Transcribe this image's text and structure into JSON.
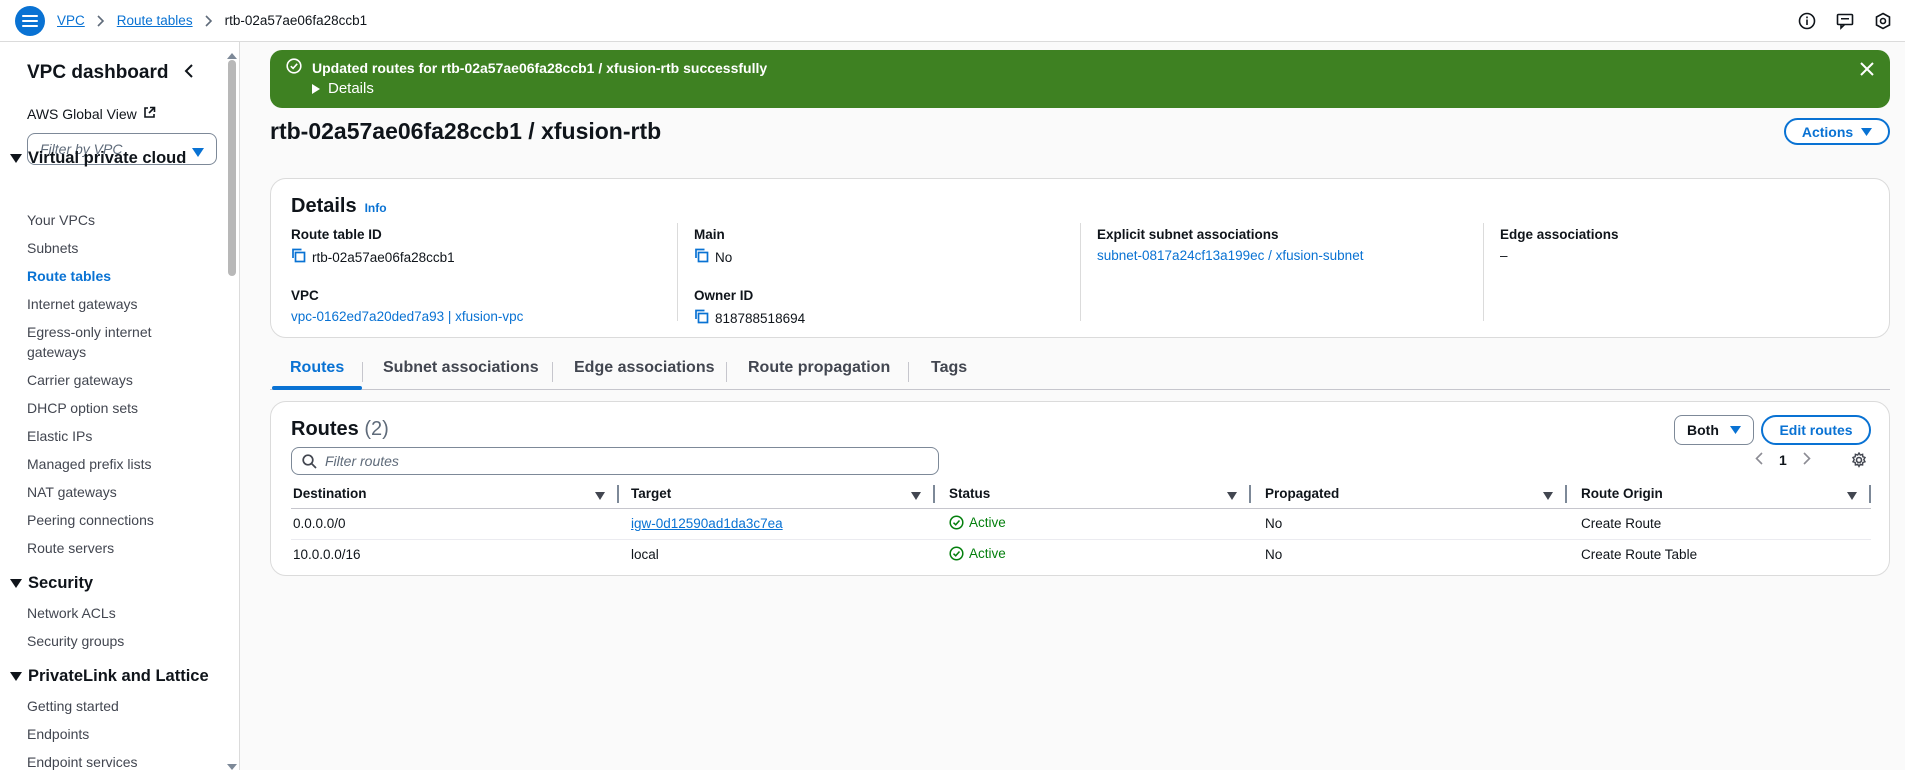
{
  "breadcrumb": {
    "items": [
      "VPC",
      "Route tables"
    ],
    "current": "rtb-02a57ae06fa28ccb1"
  },
  "sidebar": {
    "title": "VPC dashboard",
    "global_view": "AWS Global View",
    "filter_placeholder": "Filter by VPC",
    "sections": [
      {
        "title": "Virtual private cloud",
        "items": [
          "Your VPCs",
          "Subnets",
          "Route tables",
          "Internet gateways",
          "Egress-only internet gateways",
          "Carrier gateways",
          "DHCP option sets",
          "Elastic IPs",
          "Managed prefix lists",
          "NAT gateways",
          "Peering connections",
          "Route servers"
        ]
      },
      {
        "title": "Security",
        "items": [
          "Network ACLs",
          "Security groups"
        ]
      },
      {
        "title": "PrivateLink and Lattice",
        "items": [
          "Getting started",
          "Endpoints",
          "Endpoint services"
        ]
      }
    ],
    "active_item": "Route tables"
  },
  "flash": {
    "message": "Updated routes for rtb-02a57ae06fa28ccb1 / xfusion-rtb successfully",
    "details_label": "Details",
    "color": "#3e8122"
  },
  "page": {
    "title": "rtb-02a57ae06fa28ccb1 / xfusion-rtb",
    "actions_label": "Actions"
  },
  "details": {
    "title": "Details",
    "info_label": "Info",
    "route_table_id_label": "Route table ID",
    "route_table_id": "rtb-02a57ae06fa28ccb1",
    "main_label": "Main",
    "main": "No",
    "explicit_label": "Explicit subnet associations",
    "explicit": "subnet-0817a24cf13a199ec / xfusion-subnet",
    "edge_label": "Edge associations",
    "edge": "–",
    "vpc_label": "VPC",
    "vpc": "vpc-0162ed7a20ded7a93 | xfusion-vpc",
    "owner_label": "Owner ID",
    "owner": "818788518694"
  },
  "tabs": [
    "Routes",
    "Subnet associations",
    "Edge associations",
    "Route propagation",
    "Tags"
  ],
  "routes": {
    "title": "Routes",
    "count": "(2)",
    "both_label": "Both",
    "edit_label": "Edit routes",
    "filter_placeholder": "Filter routes",
    "page_number": "1",
    "columns": [
      "Destination",
      "Target",
      "Status",
      "Propagated",
      "Route Origin"
    ],
    "rows": [
      {
        "destination": "0.0.0.0/0",
        "target": "igw-0d12590ad1da3c7ea",
        "status": "Active",
        "propagated": "No",
        "origin": "Create Route"
      },
      {
        "destination": "10.0.0.0/16",
        "target": "local",
        "status": "Active",
        "propagated": "No",
        "origin": "Create Route Table"
      }
    ]
  },
  "colors": {
    "accent": "#0972d3",
    "success": "#037f0c"
  }
}
